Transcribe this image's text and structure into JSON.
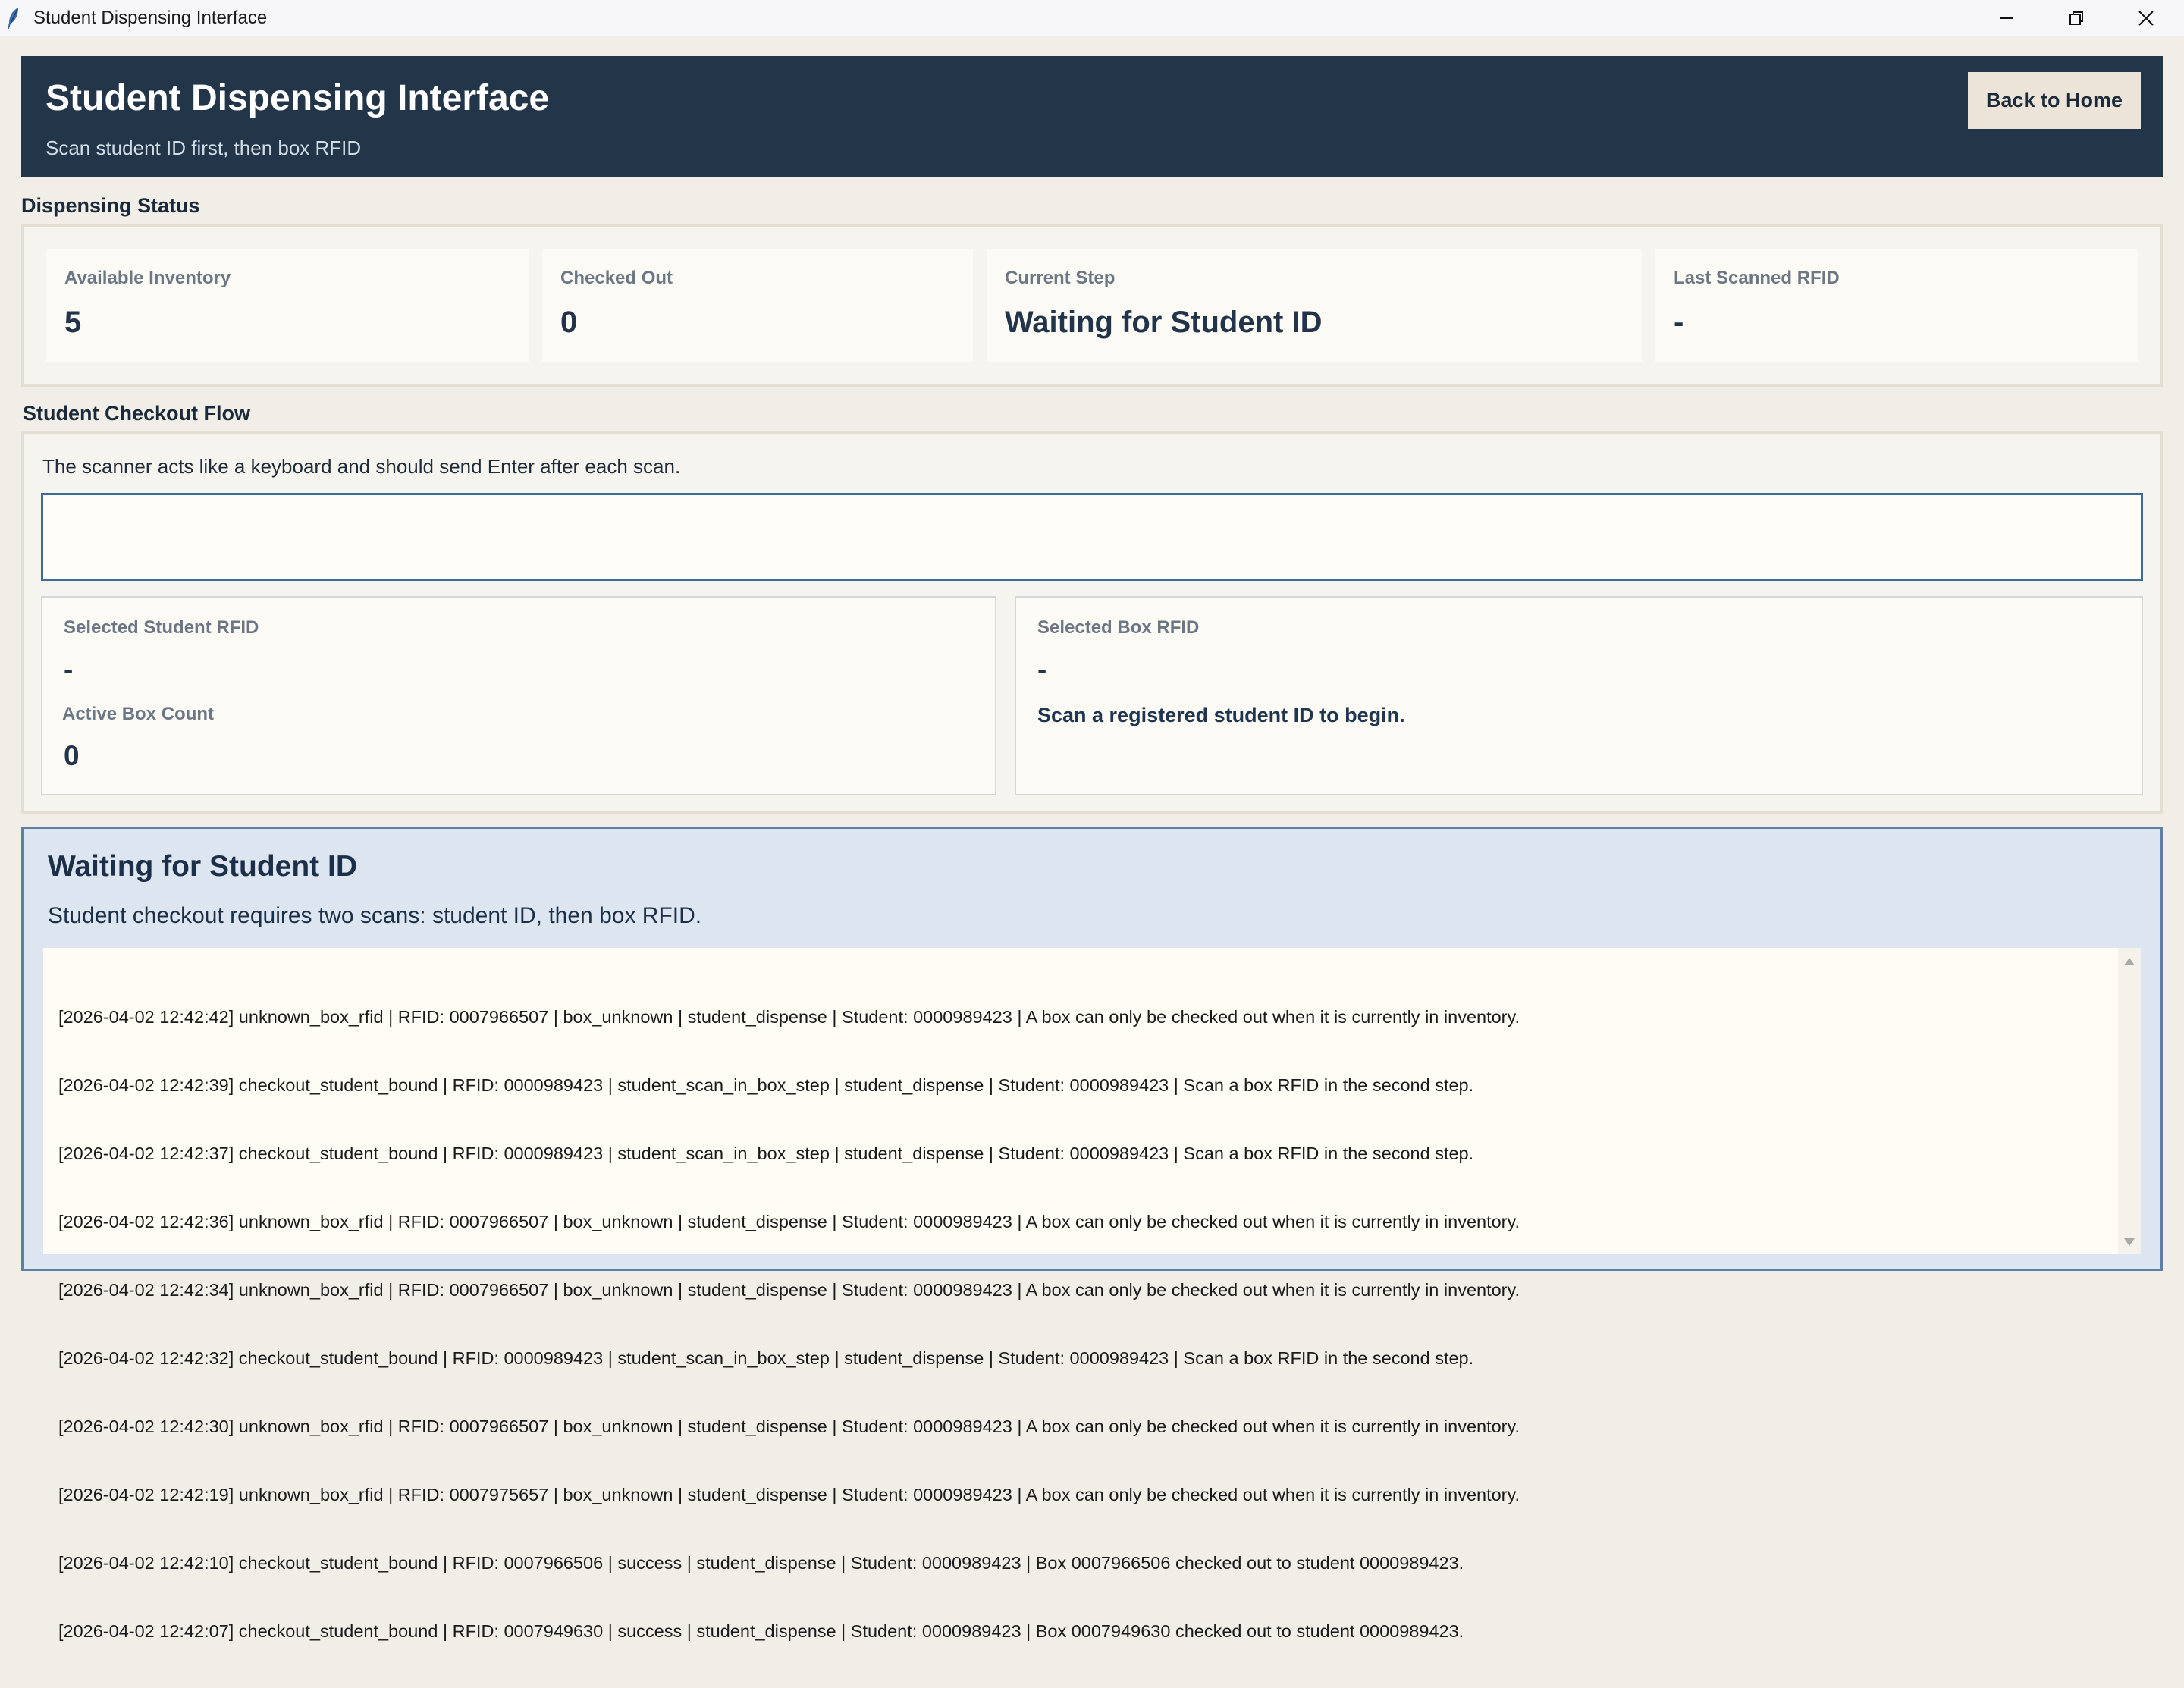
{
  "window": {
    "title": "Student Dispensing Interface",
    "controls": [
      "minimize-icon",
      "maximize-icon",
      "close-icon"
    ]
  },
  "header": {
    "title": "Student Dispensing Interface",
    "subtitle": "Scan student ID first, then box RFID",
    "back_button": "Back to Home"
  },
  "dispensing_status": {
    "label": "Dispensing Status",
    "cards": [
      {
        "label": "Available Inventory",
        "value": "5"
      },
      {
        "label": "Checked Out",
        "value": "0"
      },
      {
        "label": "Current Step",
        "value": "Waiting for Student ID"
      },
      {
        "label": "Last Scanned RFID",
        "value": "-"
      }
    ]
  },
  "checkout_flow": {
    "label": "Student Checkout Flow",
    "hint": "The scanner acts like a keyboard and should send Enter after each scan.",
    "scan_input_value": "",
    "student": {
      "rfid_label": "Selected Student RFID",
      "rfid_value": "-",
      "box_count_label": "Active Box Count",
      "box_count_value": "0"
    },
    "box": {
      "rfid_label": "Selected Box RFID",
      "rfid_value": "-",
      "message": "Scan a registered student ID to begin."
    }
  },
  "status_panel": {
    "title": "Waiting for Student ID",
    "subtitle": "Student checkout requires two scans: student ID, then box RFID.",
    "log": [
      "[2026-04-02 12:42:42] unknown_box_rfid | RFID: 0007966507 | box_unknown | student_dispense | Student: 0000989423 | A box can only be checked out when it is currently in inventory.",
      "[2026-04-02 12:42:39] checkout_student_bound | RFID: 0000989423 | student_scan_in_box_step | student_dispense | Student: 0000989423 | Scan a box RFID in the second step.",
      "[2026-04-02 12:42:37] checkout_student_bound | RFID: 0000989423 | student_scan_in_box_step | student_dispense | Student: 0000989423 | Scan a box RFID in the second step.",
      "[2026-04-02 12:42:36] unknown_box_rfid | RFID: 0007966507 | box_unknown | student_dispense | Student: 0000989423 | A box can only be checked out when it is currently in inventory.",
      "[2026-04-02 12:42:34] unknown_box_rfid | RFID: 0007966507 | box_unknown | student_dispense | Student: 0000989423 | A box can only be checked out when it is currently in inventory.",
      "[2026-04-02 12:42:32] checkout_student_bound | RFID: 0000989423 | student_scan_in_box_step | student_dispense | Student: 0000989423 | Scan a box RFID in the second step.",
      "[2026-04-02 12:42:30] unknown_box_rfid | RFID: 0007966507 | box_unknown | student_dispense | Student: 0000989423 | A box can only be checked out when it is currently in inventory.",
      "[2026-04-02 12:42:19] unknown_box_rfid | RFID: 0007975657 | box_unknown | student_dispense | Student: 0000989423 | A box can only be checked out when it is currently in inventory.",
      "[2026-04-02 12:42:10] checkout_student_bound | RFID: 0007966506 | success | student_dispense | Student: 0000989423 | Box 0007966506 checked out to student 0000989423.",
      "[2026-04-02 12:42:07] checkout_student_bound | RFID: 0007949630 | success | student_dispense | Student: 0000989423 | Box 0007949630 checked out to student 0000989423."
    ]
  },
  "colors": {
    "header_bg": "#233649",
    "window_bg": "#f1eee8",
    "status_panel_bg": "#dde6f0",
    "accent_border": "#3f6c96"
  }
}
